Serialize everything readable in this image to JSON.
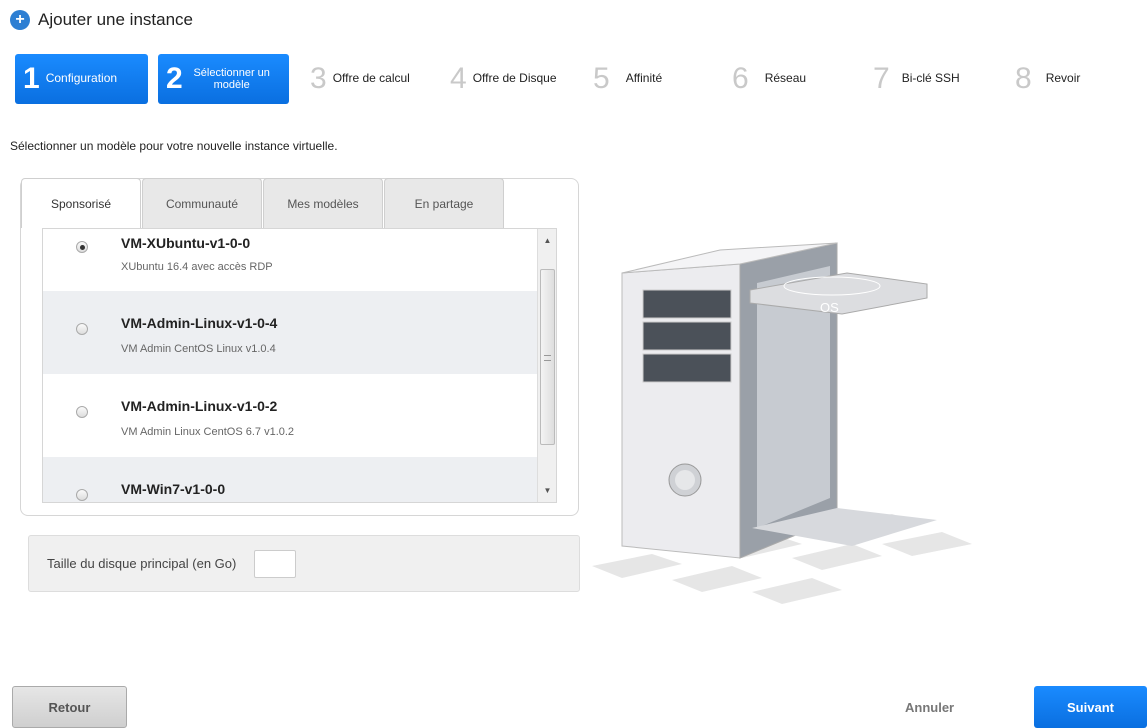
{
  "header": {
    "title": "Ajouter une instance",
    "icon": "plus-circle-icon"
  },
  "steps": [
    {
      "num": "1",
      "label": "Configuration",
      "state": "active"
    },
    {
      "num": "2",
      "label": "Sélectionner un modèle",
      "state": "active"
    },
    {
      "num": "3",
      "label": "Offre de calcul",
      "state": "inactive"
    },
    {
      "num": "4",
      "label": "Offre de Disque",
      "state": "inactive"
    },
    {
      "num": "5",
      "label": "Affinité",
      "state": "inactive"
    },
    {
      "num": "6",
      "label": "Réseau",
      "state": "inactive"
    },
    {
      "num": "7",
      "label": "Bi-clé SSH",
      "state": "inactive"
    },
    {
      "num": "8",
      "label": "Revoir",
      "state": "inactive"
    }
  ],
  "intro": "Sélectionner un modèle pour votre nouvelle instance virtuelle.",
  "tabs": [
    "Sponsorisé",
    "Communauté",
    "Mes modèles",
    "En partage"
  ],
  "templates": [
    {
      "name": "VM-XUbuntu-v1-0-0",
      "description": "XUbuntu 16.4 avec accès RDP",
      "selected": true
    },
    {
      "name": "VM-Admin-Linux-v1-0-4",
      "description": "VM Admin CentOS Linux v1.0.4",
      "selected": false
    },
    {
      "name": "VM-Admin-Linux-v1-0-2",
      "description": "VM Admin Linux CentOS 6.7 v1.0.2",
      "selected": false
    },
    {
      "name": "VM-Win7-v1-0-0",
      "description": "",
      "selected": false
    }
  ],
  "disk": {
    "label": "Taille du disque principal (en Go)",
    "value": ""
  },
  "illustration": {
    "os_label": "OS"
  },
  "footer": {
    "back": "Retour",
    "cancel": "Annuler",
    "next": "Suivant"
  },
  "colors": {
    "accent": "#0a6fe0"
  }
}
